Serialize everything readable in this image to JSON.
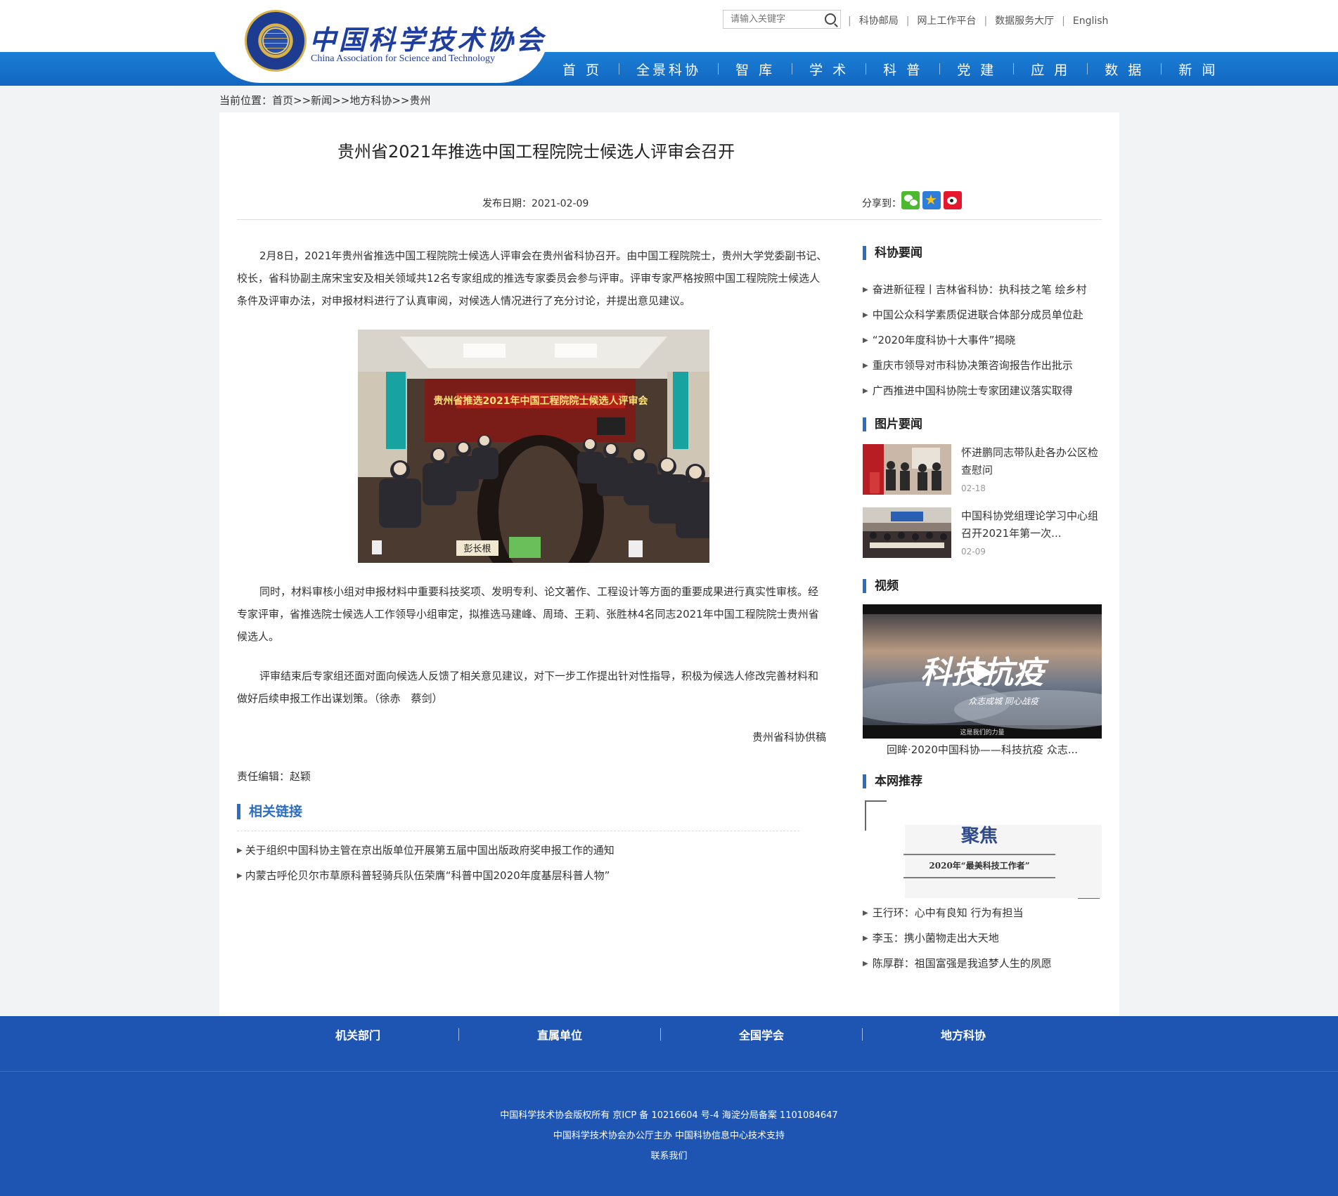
{
  "header": {
    "logo_cn": "中国科学技术协会",
    "logo_en": "China Association for Science and Technology",
    "search_placeholder": "请输入关键字",
    "top_links": [
      "科协邮局",
      "网上工作平台",
      "数据服务大厅",
      "English"
    ],
    "nav": [
      "首 页",
      "全景科协",
      "智 库",
      "学 术",
      "科 普",
      "党 建",
      "应 用",
      "数 据",
      "新 闻"
    ]
  },
  "breadcrumb": {
    "label": "当前位置：",
    "items": [
      "首页",
      "新闻",
      "地方科协",
      "贵州"
    ],
    "sep": ">>"
  },
  "article": {
    "title": "贵州省2021年推选中国工程院院士候选人评审会召开",
    "date_label": "发布日期：",
    "date": "2021-02-09",
    "share_label": "分享到：",
    "paragraphs": [
      "2月8日，2021年贵州省推选中国工程院院士候选人评审会在贵州省科协召开。由中国工程院院士，贵州大学党委副书记、校长，省科协副主席宋宝安及相关领域共12名专家组成的推选专家委员会参与评审。评审专家严格按照中国工程院院士候选人条件及评审办法，对申报材料进行了认真审阅，对候选人情况进行了充分讨论，并提出意见建议。",
      "同时，材料审核小组对申报材料中重要科技奖项、发明专利、论文著作、工程设计等方面的重要成果进行真实性审核。经专家评审，省推选院士候选人工作领导小组审定，拟推选马建峰、周琦、王莉、张胜林4名同志2021年中国工程院院士贵州省候选人。",
      "评审结束后专家组还面对面向候选人反馈了相关意见建议，对下一步工作提出针对性指导，积极为候选人修改完善材料和做好后续申报工作出谋划策。（徐赤　蔡剑）"
    ],
    "photo_banner": "贵州省推选2021年中国工程院院士候选人评审会",
    "photo_name_card": "彭长根",
    "supply": "贵州省科协供稿",
    "editor": "责任编辑：赵颖"
  },
  "related": {
    "title": "相关链接",
    "items": [
      "关于组织中国科协主管在京出版单位开展第五届中国出版政府奖申报工作的通知",
      "内蒙古呼伦贝尔市草原科普轻骑兵队伍荣膺“科普中国2020年度基层科普人物”"
    ]
  },
  "sidebar": {
    "news_title": "科协要闻",
    "news": [
      "奋进新征程丨吉林省科协：执科技之笔 绘乡村",
      "中国公众科学素质促进联合体部分成员单位赴",
      "“2020年度科协十大事件”揭晓",
      "重庆市领导对市科协决策咨询报告作出批示",
      "广西推进中国科协院士专家团建议落实取得"
    ],
    "pic_title": "图片要闻",
    "pics": [
      {
        "text": "怀进鹏同志带队赴各办公区检查慰问",
        "date": "02-18"
      },
      {
        "text": "中国科协党组理论学习中心组召开2021年第一次...",
        "date": "02-09"
      }
    ],
    "video_title": "视频",
    "video_overlay": "科技抗疫",
    "video_sub": "众志成城 同心战疫",
    "video_bottom": "这是我们的力量",
    "video_caption": "回眸·2020中国科协——科技抗疫 众志...",
    "rec_title": "本网推荐",
    "rec_banner_main": "聚焦",
    "rec_banner_sub": "2020年“最美科技工作者”",
    "rec": [
      "王行环：心中有良知 行为有担当",
      "李玉：携小菌物走出大天地",
      "陈厚群：祖国富强是我追梦人生的夙愿"
    ]
  },
  "footer": {
    "nav": [
      "机关部门",
      "直属单位",
      "全国学会",
      "地方科协"
    ],
    "line1": "中国科学技术协会版权所有 京ICP 备 10216604 号-4 海淀分局备案 1101084647",
    "line2": "中国科学技术协会办公厅主办 中国科协信息中心技术支持",
    "line3": "联系我们"
  },
  "colors": {
    "brand_blue": "#1266c0",
    "accent_blue": "#2c6ec4",
    "footer_blue": "#1e55b3"
  }
}
